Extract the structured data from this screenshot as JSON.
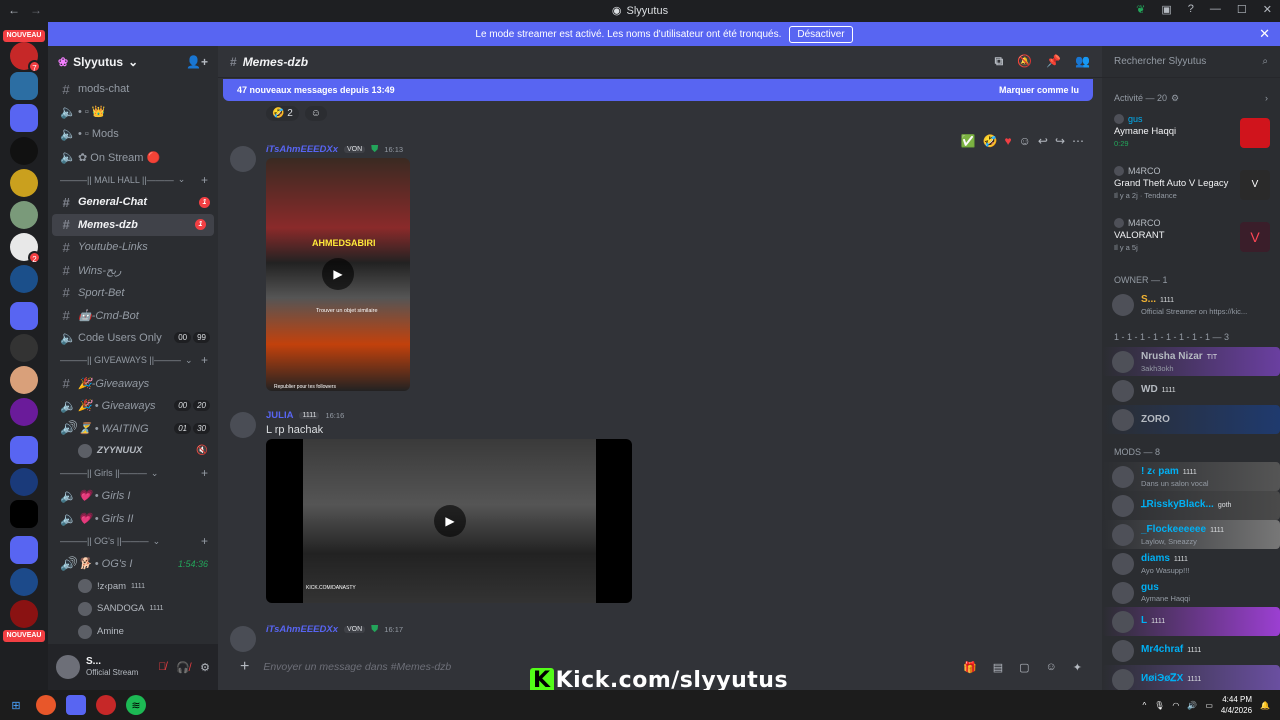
{
  "window": {
    "title": "Slyyutus"
  },
  "banner": {
    "text": "Le mode streamer est activé. Les noms d'utilisateur ont été tronqués.",
    "button": "Désactiver"
  },
  "servers": {
    "nouveau_top": "NOUVEAU",
    "nouveau_bottom": "NOUVEAU",
    "badge1": "7",
    "badge2": "2"
  },
  "guild": {
    "name": "Slyyutus"
  },
  "channels": [
    {
      "name": "mods-chat"
    },
    {
      "name": "• ▫︎ 👑"
    },
    {
      "name": "• ▫︎ Mods"
    },
    {
      "name": "✿ On Stream 🔴"
    }
  ],
  "cat_mailhall": "———|| MAIL HALL ||———",
  "mail_channels": [
    {
      "name": "General-Chat",
      "badge": "1"
    },
    {
      "name": "Memes-dzb",
      "badge": "1"
    },
    {
      "name": "Youtube-Links"
    },
    {
      "name": "Wins-ربح"
    },
    {
      "name": "Sport-Bet"
    },
    {
      "name": "🤖-Cmd-Bot"
    },
    {
      "name": "Code Users Only",
      "c1": "00",
      "c2": "99"
    }
  ],
  "cat_giveaways": "———|| GIVEAWAYS ||———",
  "give_channels": [
    {
      "name": "🎉-Giveaways"
    },
    {
      "name": "🎉 • Giveaways",
      "c1": "00",
      "c2": "20"
    },
    {
      "name": "⏳ • WAITING",
      "c1": "01",
      "c2": "30"
    }
  ],
  "give_sub": "ZYYNUUX",
  "cat_girls": "———|| Girls ||———",
  "girls_channels": [
    {
      "name": "💗 • Girls I"
    },
    {
      "name": "💗 • Girls II"
    }
  ],
  "cat_ogs": "———|| OG's ||———",
  "og_channel": {
    "name": "🐕 • OG's I",
    "timer": "1:54:36"
  },
  "og_users": [
    "!z‹pam",
    "SANDOGA",
    "Amine"
  ],
  "og_tag": "1111",
  "userbar": {
    "name": "S...",
    "status": "Official Stream"
  },
  "chat": {
    "channel": "Memes-dzb",
    "newbar": "47 nouveaux messages depuis 13:49",
    "mark_read": "Marquer comme lu",
    "reaction_count": "2",
    "msg1": {
      "author": "iTsAhmEEEDXx",
      "tag": "VON",
      "time": "16:13",
      "overlay": "AHMEDSABIRI",
      "caption": "Trouver un objet similaire",
      "repost": "Republier pour tes followers"
    },
    "msg2": {
      "author": "JULIA",
      "tag": "1111",
      "time": "16:16",
      "text": "L rp hachak",
      "watermark": "KICK.COM/DANASTY"
    },
    "msg3": {
      "author": "iTsAhmEEEDXx",
      "tag": "VON",
      "time": "16:17"
    },
    "composer_placeholder": "Envoyer un message dans #Memes-dzb"
  },
  "kick_overlay": "Kick.com/slyyutus",
  "members": {
    "search_placeholder": "Rechercher Slyyutus",
    "activity_head": "Activité — 20",
    "activities": [
      {
        "user": "gus",
        "game": "Aymane Haqqi",
        "meta": "0:29",
        "color": "#d0141c"
      },
      {
        "user": "M4RCO",
        "game": "Grand Theft Auto V Legacy",
        "meta": "Il y a 2j · Tendance",
        "color": "#2a2a2a"
      },
      {
        "user": "M4RCO",
        "game": "VALORANT",
        "meta": "Il y a 5j",
        "color": "#3a1e2a"
      }
    ],
    "owner_head": "OWNER — 1",
    "owner": {
      "name": "S...",
      "tag": "1111",
      "status": "Official Streamer on https://kic..."
    },
    "group_head": "1 - 1 - 1 - 1 - 1 - 1 - 1 - 1 — 3",
    "group": [
      {
        "name": "Nrusha Nizar",
        "tag": "TIT",
        "status": "3akh3okh",
        "color": "#b5bac1"
      },
      {
        "name": "WD",
        "tag": "1111",
        "status": "",
        "color": "#b5bac1"
      },
      {
        "name": "ZORO",
        "tag": "",
        "status": "",
        "color": "#b5bac1"
      }
    ],
    "mods_head": "MODS — 8",
    "mods": [
      {
        "name": "! z‹ pam",
        "tag": "1111",
        "status": "Dans un salon vocal",
        "color": "#00b0f4"
      },
      {
        "name": "ꞱRisskyBlack...",
        "tag": "goth",
        "status": "",
        "color": "#00b0f4"
      },
      {
        "name": "_Flockeeeeee",
        "tag": "1111",
        "status": "Laylow, Sneazzy",
        "color": "#00b0f4"
      },
      {
        "name": "diams",
        "tag": "1111",
        "status": "Ayo Wasupp!!!",
        "color": "#00b0f4"
      },
      {
        "name": "gus",
        "tag": "",
        "status": "Aymane Haqqi",
        "color": "#00b0f4"
      },
      {
        "name": "L",
        "tag": "1111",
        "status": "",
        "color": "#00b0f4"
      },
      {
        "name": "Mr4chraf",
        "tag": "1111",
        "status": "",
        "color": "#00b0f4"
      },
      {
        "name": "ИøiЭøᏃX",
        "tag": "1111",
        "status": "",
        "color": "#00b0f4"
      }
    ]
  },
  "taskbar": {
    "time": "4:44 PM",
    "date": "4/4/2026"
  }
}
